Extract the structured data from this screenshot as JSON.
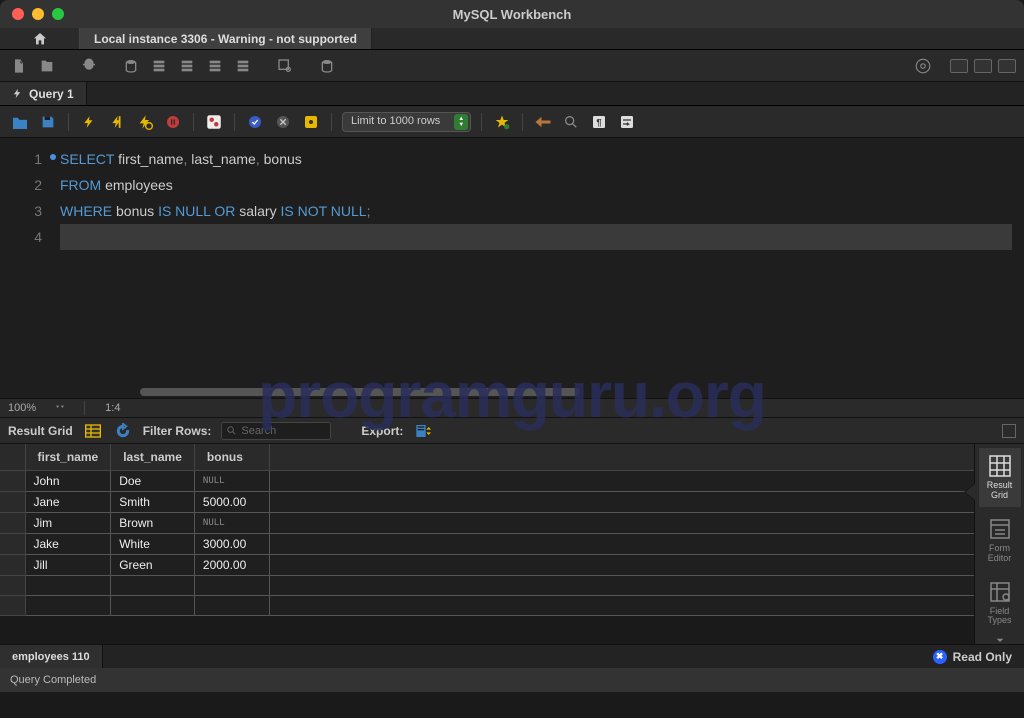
{
  "app_title": "MySQL Workbench",
  "connection_tab": "Local instance 3306 - Warning - not supported",
  "query_tab": "Query 1",
  "limit_label": "Limit to 1000 rows",
  "editor": {
    "zoom": "100%",
    "cursor": "1:4",
    "lines": [
      {
        "n": "1",
        "tokens": [
          {
            "t": "SELECT",
            "c": "kw"
          },
          {
            "t": " first_name",
            "c": ""
          },
          {
            "t": ",",
            "c": "fn"
          },
          {
            "t": " last_name",
            "c": ""
          },
          {
            "t": ",",
            "c": "fn"
          },
          {
            "t": " bonus",
            "c": ""
          }
        ]
      },
      {
        "n": "2",
        "tokens": [
          {
            "t": "FROM",
            "c": "kw"
          },
          {
            "t": " employees",
            "c": ""
          }
        ]
      },
      {
        "n": "3",
        "tokens": [
          {
            "t": "WHERE",
            "c": "kw"
          },
          {
            "t": " bonus ",
            "c": ""
          },
          {
            "t": "IS NULL OR",
            "c": "op"
          },
          {
            "t": " salary ",
            "c": ""
          },
          {
            "t": "IS NOT NULL",
            "c": "op"
          },
          {
            "t": ";",
            "c": "fn"
          }
        ]
      },
      {
        "n": "4",
        "tokens": []
      }
    ]
  },
  "result_toolbar": {
    "label": "Result Grid",
    "filter_label": "Filter Rows:",
    "search_placeholder": "Search",
    "export_label": "Export:"
  },
  "columns": [
    "first_name",
    "last_name",
    "bonus"
  ],
  "rows": [
    {
      "first_name": "John",
      "last_name": "Doe",
      "bonus": "NULL"
    },
    {
      "first_name": "Jane",
      "last_name": "Smith",
      "bonus": "5000.00"
    },
    {
      "first_name": "Jim",
      "last_name": "Brown",
      "bonus": "NULL"
    },
    {
      "first_name": "Jake",
      "last_name": "White",
      "bonus": "3000.00"
    },
    {
      "first_name": "Jill",
      "last_name": "Green",
      "bonus": "2000.00"
    }
  ],
  "side_panel": {
    "result_grid": "Result Grid",
    "form_editor": "Form Editor",
    "field_types": "Field Types"
  },
  "bottom_tab": "employees 110",
  "readonly_label": "Read Only",
  "footer_status": "Query Completed",
  "watermark": "programguru.org"
}
